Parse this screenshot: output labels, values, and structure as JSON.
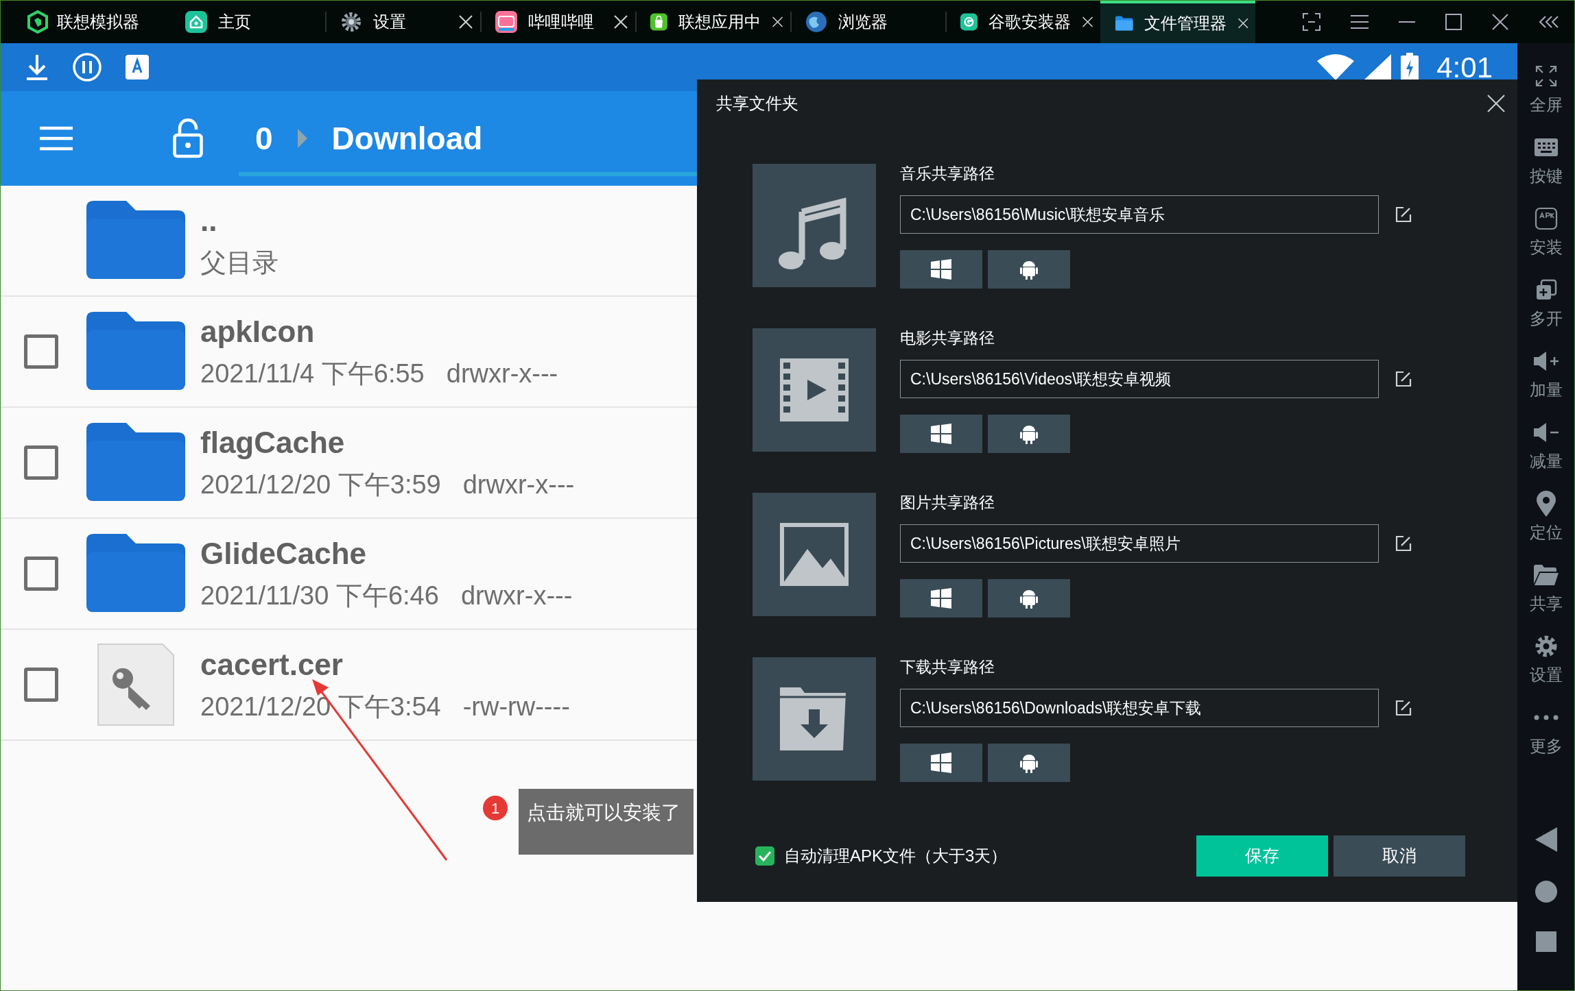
{
  "title_bar": {
    "brand": "联想模拟器",
    "tabs": [
      {
        "label": "主页",
        "kind": "home",
        "closable": false,
        "selected": false
      },
      {
        "label": "设置",
        "kind": "gear",
        "closable": true,
        "selected": false
      },
      {
        "label": "哔哩哔哩",
        "kind": "video",
        "closable": true,
        "selected": false
      },
      {
        "label": "联想应用中",
        "kind": "store",
        "closable": true,
        "selected": false
      },
      {
        "label": "浏览器",
        "kind": "globe",
        "closable": false,
        "selected": false
      },
      {
        "label": "谷歌安装器",
        "kind": "installer",
        "closable": true,
        "selected": false
      },
      {
        "label": "文件管理器",
        "kind": "folder",
        "closable": true,
        "selected": true
      }
    ]
  },
  "status_bar": {
    "time": "4:01"
  },
  "toolbar": {
    "breadcrumb": [
      "0",
      "Download"
    ]
  },
  "files": [
    {
      "kind": "parent",
      "name": "..",
      "subtitle": "父目录"
    },
    {
      "kind": "folder",
      "name": "apkIcon",
      "date": "2021/11/4 下午6:55",
      "perms": "drwxr-x---",
      "checked": false
    },
    {
      "kind": "folder",
      "name": "flagCache",
      "date": "2021/12/20 下午3:59",
      "perms": "drwxr-x---",
      "checked": false
    },
    {
      "kind": "folder",
      "name": "GlideCache",
      "date": "2021/11/30 下午6:46",
      "perms": "drwxr-x---",
      "checked": false
    },
    {
      "kind": "file",
      "name": "cacert.cer",
      "date": "2021/12/20 下午3:54",
      "perms": "-rw-rw----",
      "checked": false
    }
  ],
  "annotation": {
    "number": "1",
    "text": "点击就可以安装了"
  },
  "dialog": {
    "title": "共享文件夹",
    "sections": [
      {
        "kind": "music",
        "label": "音乐共享路径",
        "path": "C:\\Users\\86156\\Music\\联想安卓音乐"
      },
      {
        "kind": "video",
        "label": "电影共享路径",
        "path": "C:\\Users\\86156\\Videos\\联想安卓视频"
      },
      {
        "kind": "picture",
        "label": "图片共享路径",
        "path": "C:\\Users\\86156\\Pictures\\联想安卓照片"
      },
      {
        "kind": "download",
        "label": "下载共享路径",
        "path": "C:\\Users\\86156\\Downloads\\联想安卓下载"
      }
    ],
    "auto_clean": {
      "label": "自动清理APK文件（大于3天）",
      "checked": true
    },
    "buttons": [
      {
        "kind": "primary",
        "label": "保存"
      },
      {
        "kind": "secondary",
        "label": "取消"
      }
    ]
  },
  "sidebar": [
    {
      "kind": "fullscreen",
      "label": "全屏"
    },
    {
      "kind": "keyboard",
      "label": "按键"
    },
    {
      "kind": "apk",
      "label": "安装"
    },
    {
      "kind": "multi",
      "label": "多开"
    },
    {
      "kind": "volup",
      "label": "加量"
    },
    {
      "kind": "voldown",
      "label": "减量"
    },
    {
      "kind": "pin",
      "label": "定位"
    },
    {
      "kind": "folder",
      "label": "共享"
    },
    {
      "kind": "gear",
      "label": "设置"
    },
    {
      "kind": "dots",
      "label": "更多"
    }
  ]
}
